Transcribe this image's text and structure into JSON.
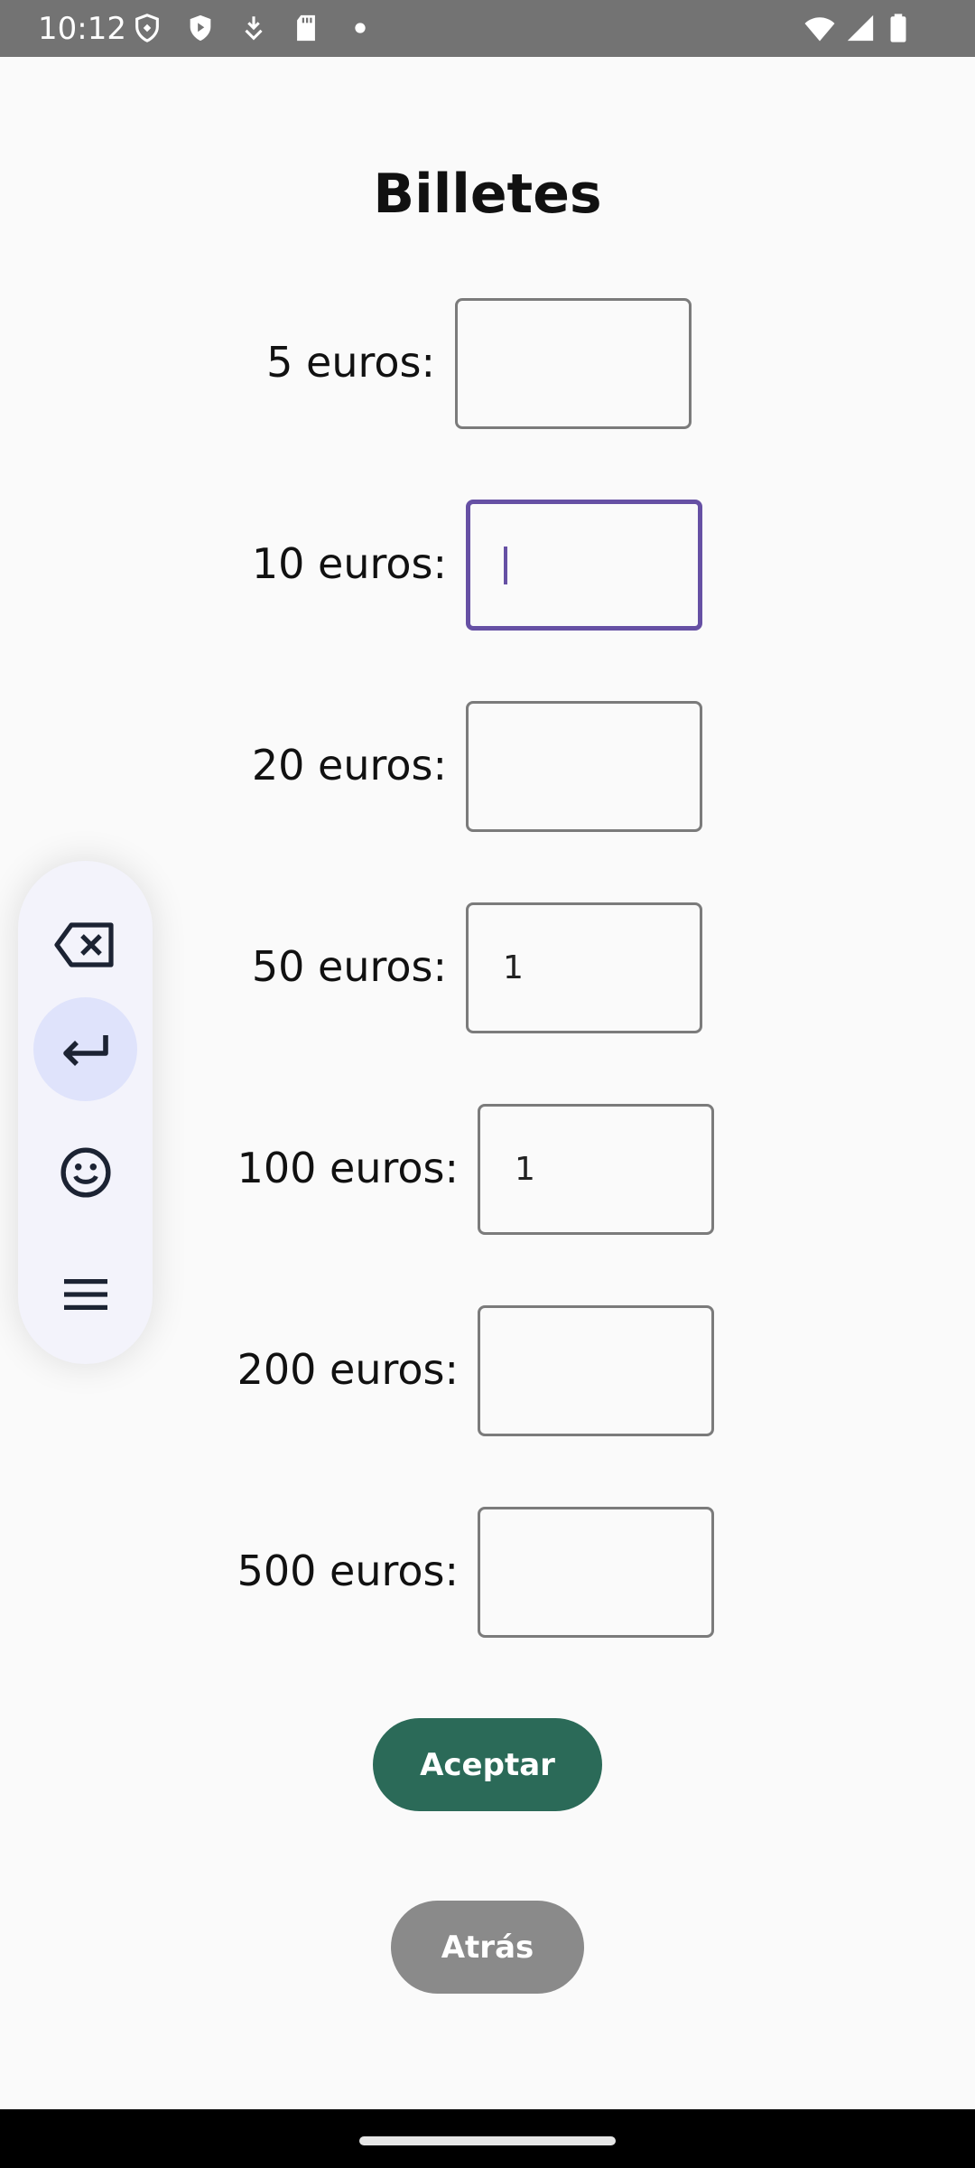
{
  "status_bar": {
    "time": "10:12",
    "left_icons": [
      "shield-outline-icon",
      "play-shield-icon",
      "download-icon",
      "sd-card-icon",
      "dot-icon"
    ],
    "right_icons": [
      "wifi-icon",
      "signal-icon",
      "battery-icon"
    ]
  },
  "page": {
    "title": "Billetes"
  },
  "rows": [
    {
      "label": "5 euros:",
      "value": ""
    },
    {
      "label": "10 euros:",
      "value": ""
    },
    {
      "label": "20 euros:",
      "value": ""
    },
    {
      "label": "50 euros:",
      "value": "1"
    },
    {
      "label": "100 euros:",
      "value": "1"
    },
    {
      "label": "200 euros:",
      "value": ""
    },
    {
      "label": "500 euros:",
      "value": ""
    }
  ],
  "buttons": {
    "accept_label": "Aceptar",
    "back_label": "Atrás"
  },
  "keyboard_toolbar": {
    "items": [
      "backspace-icon",
      "enter-icon",
      "emoji-icon",
      "menu-icon"
    ],
    "active": "enter-icon"
  },
  "colors": {
    "accent": "#6650a4",
    "accept": "#2b6a58",
    "back": "#8a8a8a"
  }
}
